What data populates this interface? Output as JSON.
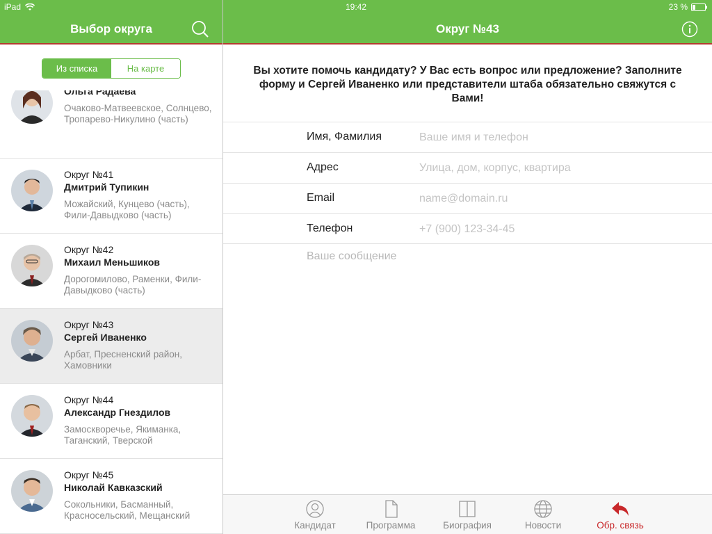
{
  "status_bar": {
    "device": "iPad",
    "time": "19:42",
    "battery": "23 %"
  },
  "left_panel": {
    "title": "Выбор округа",
    "segments": [
      {
        "label": "Из списка",
        "active": true
      },
      {
        "label": "На карте",
        "active": false
      }
    ],
    "candidates": [
      {
        "district": "",
        "name": "Ольга Радаева",
        "areas": "Очаково-Матвеевское, Солнцево, Тропарево-Никулино (часть)",
        "selected": false
      },
      {
        "district": "Округ №41",
        "name": "Дмитрий Тупикин",
        "areas": "Можайский, Кунцево (часть), Фили-Давыдково (часть)",
        "selected": false
      },
      {
        "district": "Округ №42",
        "name": "Михаил Меньшиков",
        "areas": "Дорогомилово, Раменки, Фили-Давыдково (часть)",
        "selected": false
      },
      {
        "district": "Округ №43",
        "name": "Сергей Иваненко",
        "areas": "Арбат, Пресненский район, Хамовники",
        "selected": true
      },
      {
        "district": "Округ №44",
        "name": "Александр Гнездилов",
        "areas": "Замоскворечье, Якиманка, Таганский, Тверской",
        "selected": false
      },
      {
        "district": "Округ №45",
        "name": "Николай Кавказский",
        "areas": "Сокольники, Басманный, Красносельский, Мещанский",
        "selected": false
      }
    ]
  },
  "right_panel": {
    "title": "Округ №43",
    "intro": "Вы хотите помочь кандидату? У Вас есть вопрос или предложение? Заполните форму и Сергей Иваненко или представители штаба обязательно свяжутся с Вами!",
    "form": {
      "name_label": "Имя, Фамилия",
      "name_placeholder": "Ваше имя и телефон",
      "address_label": "Адрес",
      "address_placeholder": "Улица, дом, корпус, квартира",
      "email_label": "Email",
      "email_placeholder": "name@domain.ru",
      "phone_label": "Телефон",
      "phone_placeholder": "+7 (900) 123-34-45",
      "message_placeholder": "Ваше сообщение"
    },
    "tabs": [
      {
        "label": "Кандидат",
        "icon": "person-icon"
      },
      {
        "label": "Программа",
        "icon": "document-icon"
      },
      {
        "label": "Биография",
        "icon": "book-icon"
      },
      {
        "label": "Новости",
        "icon": "globe-icon"
      },
      {
        "label": "Обр. связь",
        "icon": "reply-icon",
        "active": true
      }
    ]
  },
  "colors": {
    "accent_green": "#6bbd4a",
    "accent_red": "#c8282a"
  }
}
